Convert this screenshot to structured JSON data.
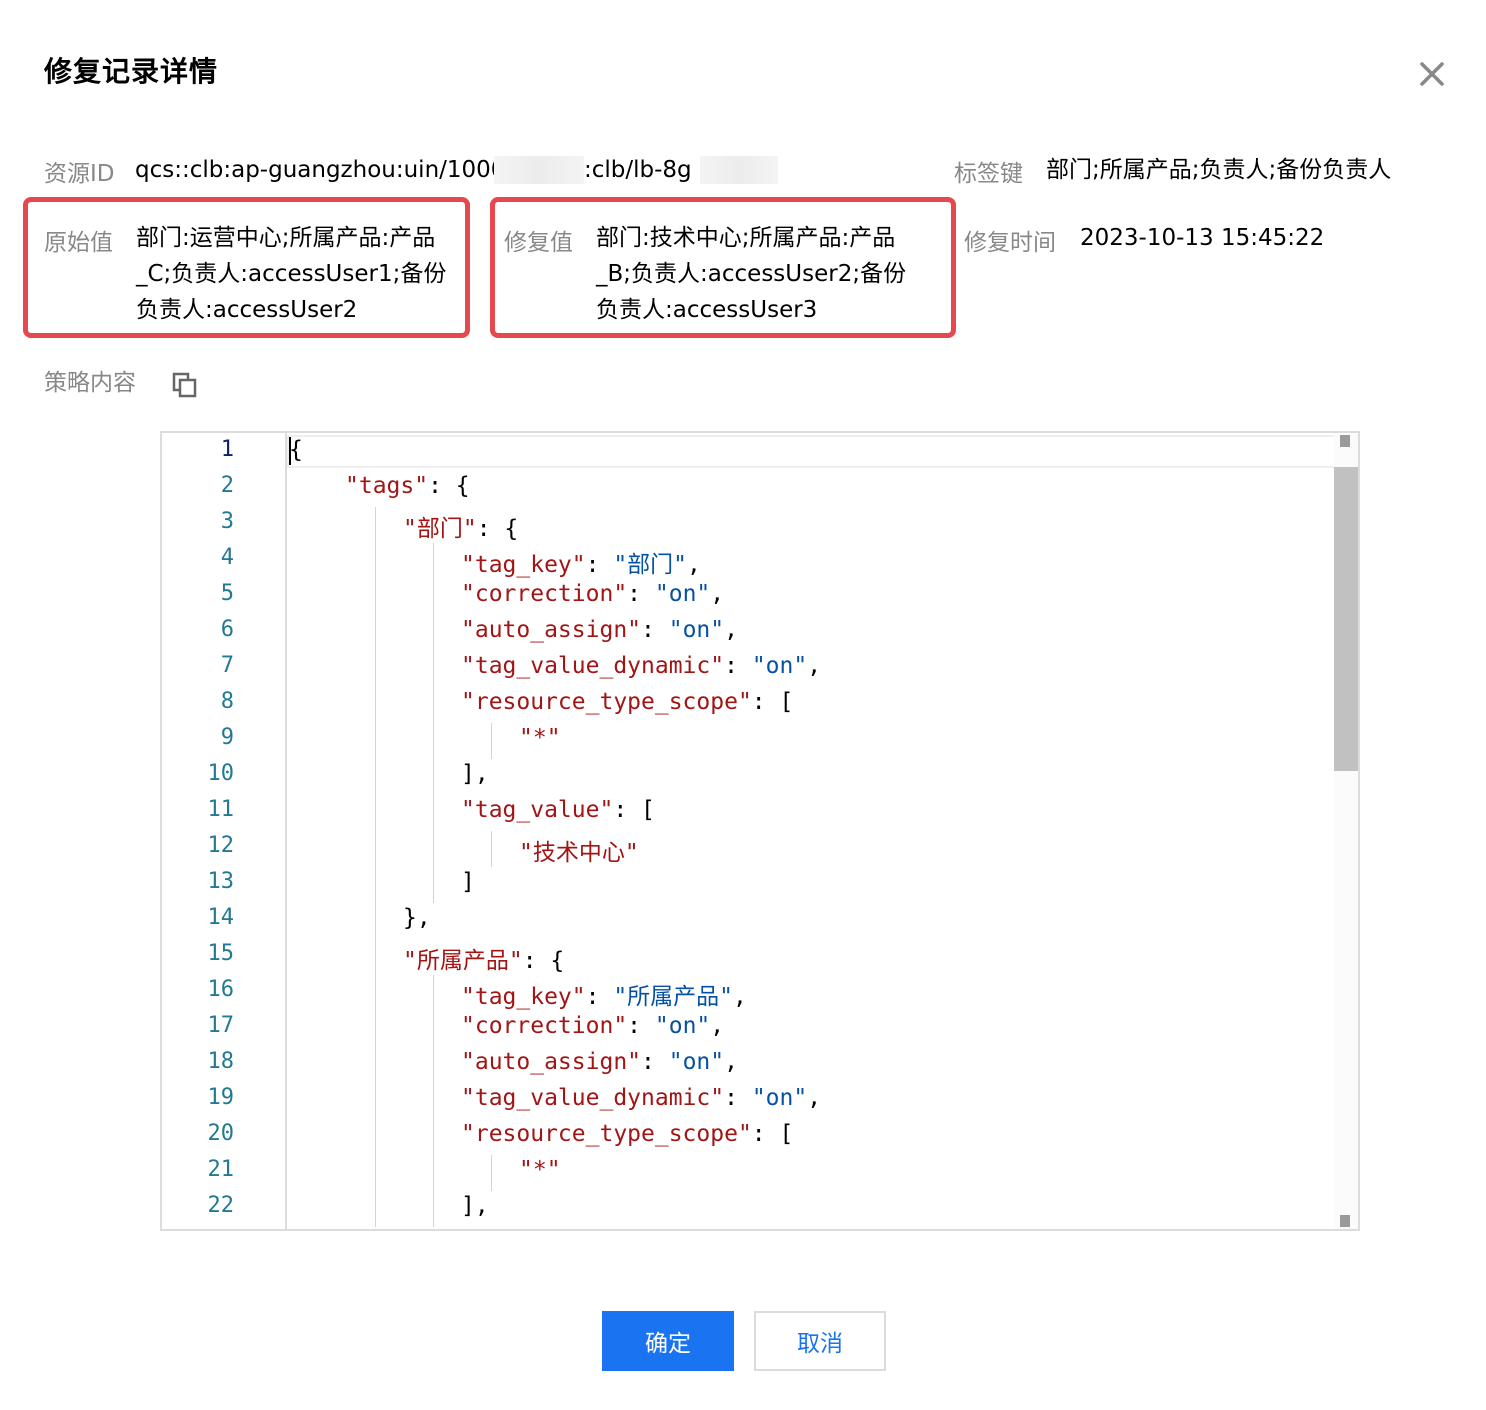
{
  "dialog": {
    "title": "修复记录详情",
    "close_icon": "close-icon"
  },
  "fields": {
    "resource_id_label": "资源ID",
    "resource_id_part1": "qcs::clb:ap-guangzhou:uin/10002",
    "resource_id_part2": ":clb/lb-8g",
    "tag_key_label": "标签键",
    "tag_key_value": "部门;所属产品;负责人;备份负责人",
    "original_label": "原始值",
    "original_lines": [
      "部门:运营中心;所属产品:产品",
      "_C;负责人:accessUser1;备份",
      "负责人:accessUser2"
    ],
    "fixed_label": "修复值",
    "fixed_lines": [
      "部门:技术中心;所属产品:产品",
      "_B;负责人:accessUser2;备份",
      "负责人:accessUser3"
    ],
    "fix_time_label": "修复时间",
    "fix_time_value": "2023-10-13 15:45:22",
    "policy_label": "策略内容",
    "copy_icon": "copy-icon"
  },
  "editor": {
    "line_numbers": [
      "1",
      "2",
      "3",
      "4",
      "5",
      "6",
      "7",
      "8",
      "9",
      "10",
      "11",
      "12",
      "13",
      "14",
      "15",
      "16",
      "17",
      "18",
      "19",
      "20",
      "21",
      "22"
    ],
    "lines": [
      [
        {
          "t": "{",
          "c": "p"
        }
      ],
      [
        {
          "t": "\"tags\"",
          "c": "k"
        },
        {
          "t": ": {",
          "c": "p"
        }
      ],
      [
        {
          "t": "\"部门\"",
          "c": "k"
        },
        {
          "t": ": {",
          "c": "p"
        }
      ],
      [
        {
          "t": "\"tag_key\"",
          "c": "k"
        },
        {
          "t": ": ",
          "c": "p"
        },
        {
          "t": "\"部门\"",
          "c": "s"
        },
        {
          "t": ",",
          "c": "p"
        }
      ],
      [
        {
          "t": "\"correction\"",
          "c": "k"
        },
        {
          "t": ": ",
          "c": "p"
        },
        {
          "t": "\"on\"",
          "c": "s"
        },
        {
          "t": ",",
          "c": "p"
        }
      ],
      [
        {
          "t": "\"auto_assign\"",
          "c": "k"
        },
        {
          "t": ": ",
          "c": "p"
        },
        {
          "t": "\"on\"",
          "c": "s"
        },
        {
          "t": ",",
          "c": "p"
        }
      ],
      [
        {
          "t": "\"tag_value_dynamic\"",
          "c": "k"
        },
        {
          "t": ": ",
          "c": "p"
        },
        {
          "t": "\"on\"",
          "c": "s"
        },
        {
          "t": ",",
          "c": "p"
        }
      ],
      [
        {
          "t": "\"resource_type_scope\"",
          "c": "k"
        },
        {
          "t": ": [",
          "c": "p"
        }
      ],
      [
        {
          "t": "\"*\"",
          "c": "k"
        }
      ],
      [
        {
          "t": "],",
          "c": "p"
        }
      ],
      [
        {
          "t": "\"tag_value\"",
          "c": "k"
        },
        {
          "t": ": [",
          "c": "p"
        }
      ],
      [
        {
          "t": "\"技术中心\"",
          "c": "k"
        }
      ],
      [
        {
          "t": "]",
          "c": "p"
        }
      ],
      [
        {
          "t": "},",
          "c": "p"
        }
      ],
      [
        {
          "t": "\"所属产品\"",
          "c": "k"
        },
        {
          "t": ": {",
          "c": "p"
        }
      ],
      [
        {
          "t": "\"tag_key\"",
          "c": "k"
        },
        {
          "t": ": ",
          "c": "p"
        },
        {
          "t": "\"所属产品\"",
          "c": "s"
        },
        {
          "t": ",",
          "c": "p"
        }
      ],
      [
        {
          "t": "\"correction\"",
          "c": "k"
        },
        {
          "t": ": ",
          "c": "p"
        },
        {
          "t": "\"on\"",
          "c": "s"
        },
        {
          "t": ",",
          "c": "p"
        }
      ],
      [
        {
          "t": "\"auto_assign\"",
          "c": "k"
        },
        {
          "t": ": ",
          "c": "p"
        },
        {
          "t": "\"on\"",
          "c": "s"
        },
        {
          "t": ",",
          "c": "p"
        }
      ],
      [
        {
          "t": "\"tag_value_dynamic\"",
          "c": "k"
        },
        {
          "t": ": ",
          "c": "p"
        },
        {
          "t": "\"on\"",
          "c": "s"
        },
        {
          "t": ",",
          "c": "p"
        }
      ],
      [
        {
          "t": "\"resource_type_scope\"",
          "c": "k"
        },
        {
          "t": ": [",
          "c": "p"
        }
      ],
      [
        {
          "t": "\"*\"",
          "c": "k"
        }
      ],
      [
        {
          "t": "],",
          "c": "p"
        }
      ]
    ],
    "indent_levels": [
      0,
      1,
      2,
      3,
      3,
      3,
      3,
      3,
      4,
      3,
      3,
      4,
      3,
      2,
      2,
      3,
      3,
      3,
      3,
      3,
      4,
      3
    ]
  },
  "buttons": {
    "ok_label": "确定",
    "cancel_label": "取消"
  },
  "colors": {
    "accent": "#1a73f0",
    "highlight_border": "#e5484d",
    "json_key": "#a31515",
    "json_string": "#0451a5"
  }
}
